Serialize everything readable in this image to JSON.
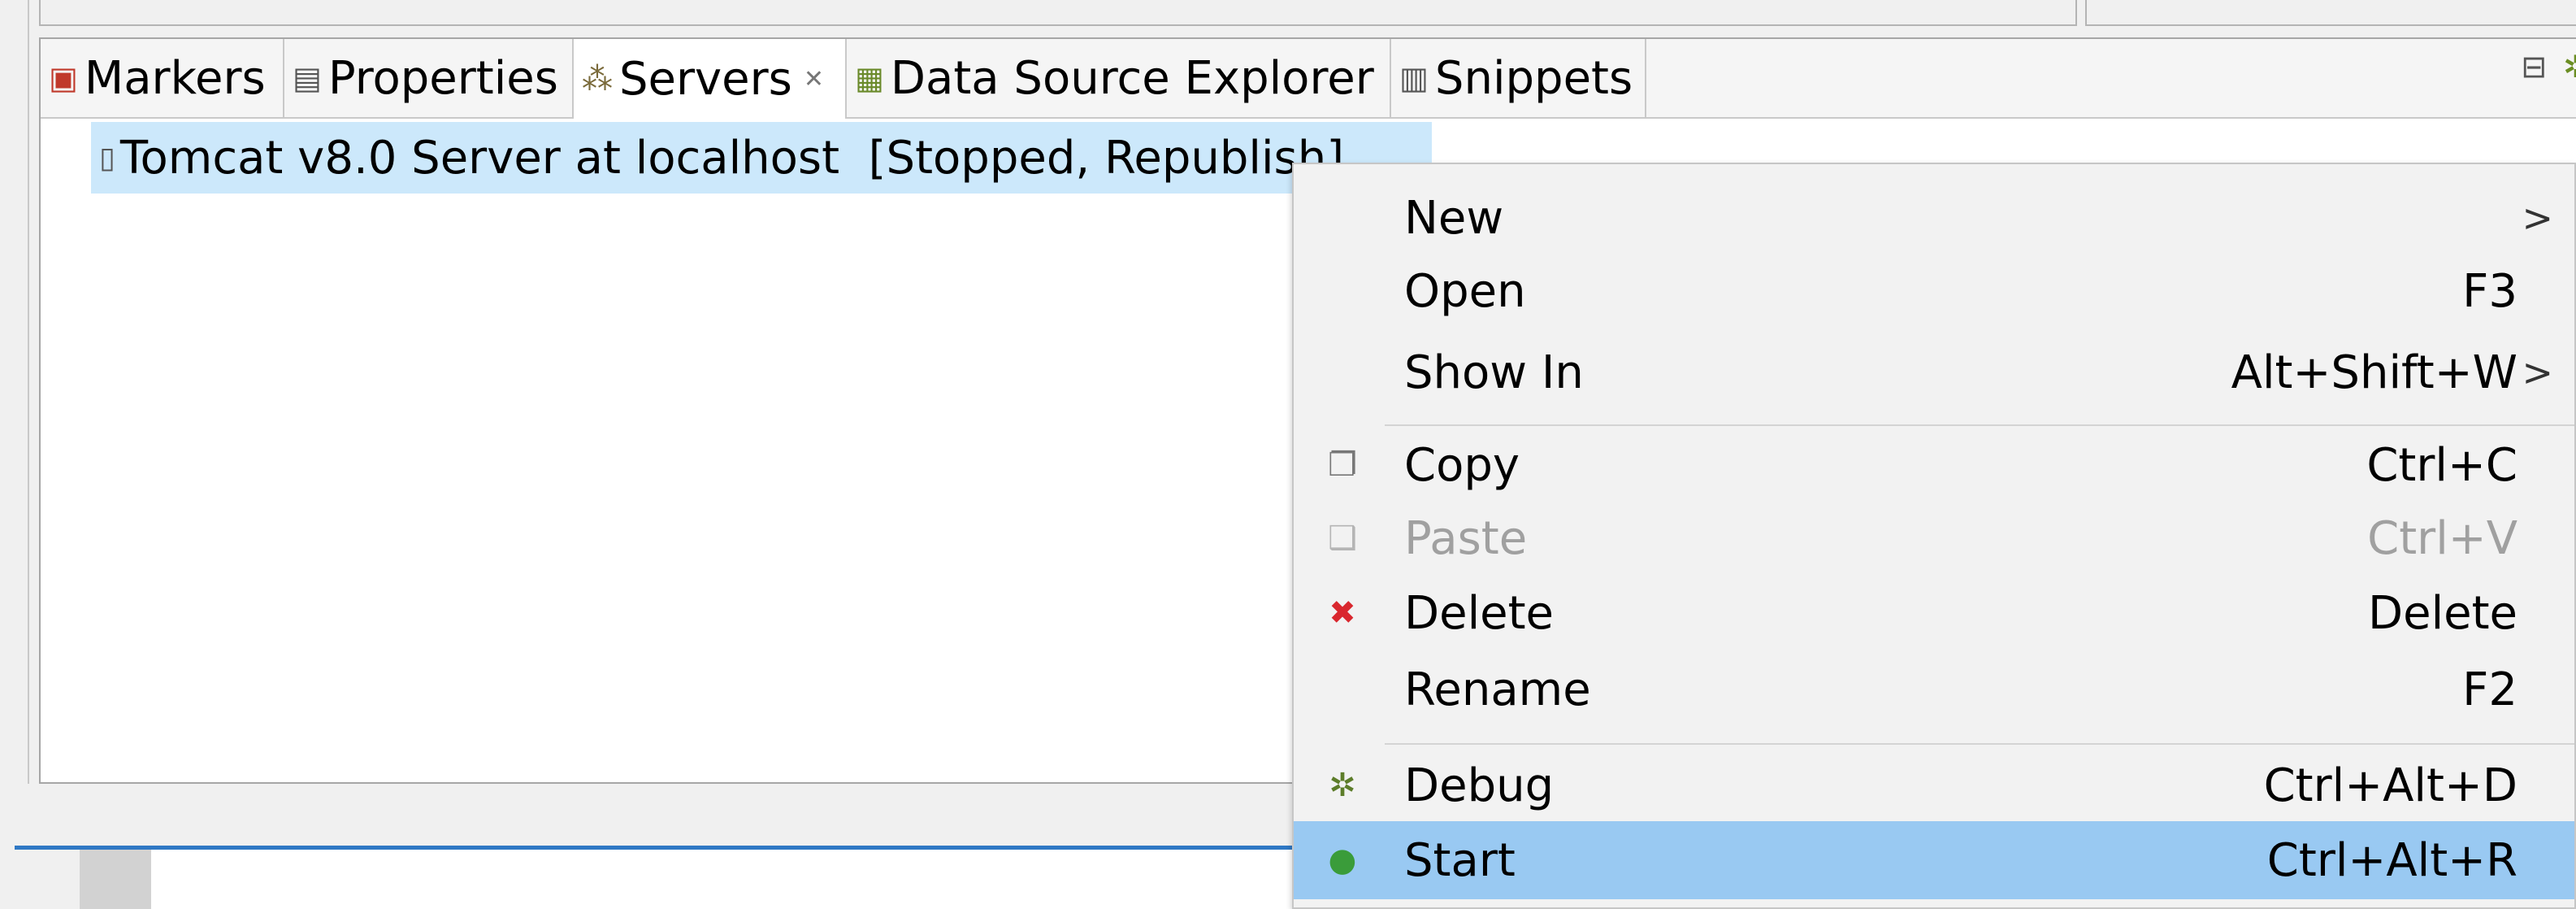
{
  "tabs": [
    {
      "label": "Markers",
      "icon": "markers-icon",
      "active": false
    },
    {
      "label": "Properties",
      "icon": "properties-icon",
      "active": false
    },
    {
      "label": "Servers",
      "icon": "servers-icon",
      "active": true
    },
    {
      "label": "Data Source Explorer",
      "icon": "data-source-icon",
      "active": false
    },
    {
      "label": "Snippets",
      "icon": "snippets-icon",
      "active": false
    }
  ],
  "servers": [
    {
      "text": "Tomcat v8.0 Server at localhost  [Stopped, Republish]",
      "icon": "server-icon"
    }
  ],
  "context_menu": [
    {
      "label": "New",
      "accel": "",
      "submenu": true,
      "icon": "",
      "enabled": true
    },
    {
      "label": "Open",
      "accel": "F3",
      "submenu": false,
      "icon": "",
      "enabled": true
    },
    {
      "label": "Show In",
      "accel": "Alt+Shift+W",
      "submenu": true,
      "icon": "",
      "enabled": true
    },
    {
      "label": "Copy",
      "accel": "Ctrl+C",
      "submenu": false,
      "icon": "copy-icon",
      "enabled": true
    },
    {
      "label": "Paste",
      "accel": "Ctrl+V",
      "submenu": false,
      "icon": "paste-icon",
      "enabled": false
    },
    {
      "label": "Delete",
      "accel": "Delete",
      "submenu": false,
      "icon": "delete-icon",
      "enabled": true
    },
    {
      "label": "Rename",
      "accel": "F2",
      "submenu": false,
      "icon": "",
      "enabled": true
    },
    {
      "label": "Debug",
      "accel": "Ctrl+Alt+D",
      "submenu": false,
      "icon": "debug-icon",
      "enabled": true
    },
    {
      "label": "Start",
      "accel": "Ctrl+Alt+R",
      "submenu": false,
      "icon": "start-icon",
      "enabled": true,
      "highlighted": true
    }
  ],
  "colors": {
    "selection": "#cce8fb",
    "menu_highlight": "#99c9f2",
    "delete_red": "#d9272e",
    "start_green": "#3a9c3a"
  }
}
